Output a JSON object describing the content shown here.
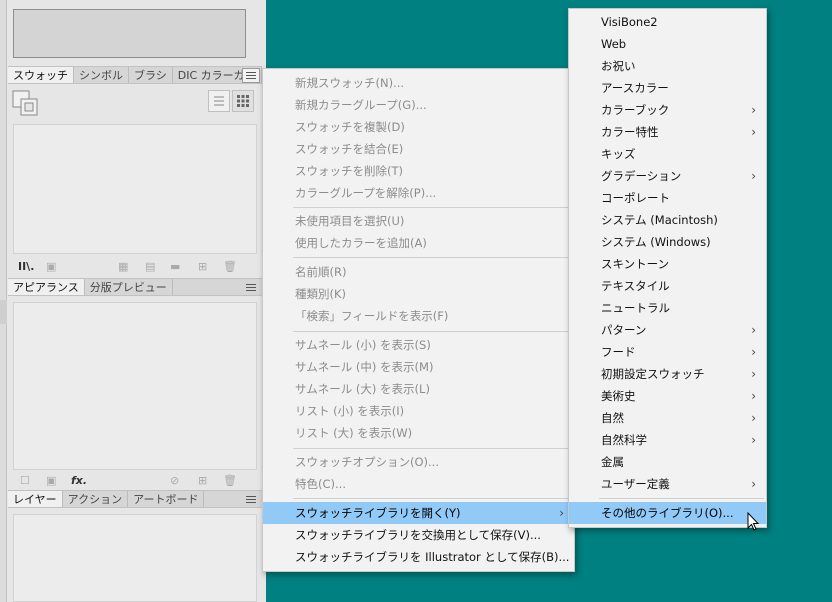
{
  "swatches_panel": {
    "tabs": [
      "スウォッチ",
      "シンボル",
      "ブラシ",
      "DIC カラーガイ"
    ]
  },
  "appearance_panel": {
    "tabs": [
      "アピアランス",
      "分版プレビュー"
    ],
    "fx_label": "fx."
  },
  "layers_panel": {
    "tabs": [
      "レイヤー",
      "アクション",
      "アートボード"
    ]
  },
  "panel_menu": {
    "items": [
      "新規スウォッチ(N)...",
      "新規カラーグループ(G)...",
      "スウォッチを複製(D)",
      "スウォッチを結合(E)",
      "スウォッチを削除(T)",
      "カラーグループを解除(P)...",
      "未使用項目を選択(U)",
      "使用したカラーを追加(A)",
      "名前順(R)",
      "種類別(K)",
      "「検索」フィールドを表示(F)",
      "サムネール (小) を表示(S)",
      "サムネール (中) を表示(M)",
      "サムネール (大) を表示(L)",
      "リスト (小) を表示(I)",
      "リスト (大) を表示(W)",
      "スウォッチオプション(O)...",
      "特色(C)...",
      "スウォッチライブラリを開く(Y)",
      "スウォッチライブラリを交換用として保存(V)...",
      "スウォッチライブラリを Illustrator として保存(B)..."
    ]
  },
  "library_submenu": {
    "items": [
      "VisiBone2",
      "Web",
      "お祝い",
      "アースカラー",
      "カラーブック",
      "カラー特性",
      "キッズ",
      "グラデーション",
      "コーポレート",
      "システム (Macintosh)",
      "システム (Windows)",
      "スキントーン",
      "テキスタイル",
      "ニュートラル",
      "パターン",
      "フード",
      "初期設定スウォッチ",
      "美術史",
      "自然",
      "自然科学",
      "金属",
      "ユーザー定義",
      "その他のライブラリ(O)..."
    ]
  },
  "icons": {
    "submenu_arrow": "›"
  },
  "colors": {
    "desktop": "#008080",
    "menu_highlight": "#91c9f7",
    "disabled_text": "#8c8c8c"
  }
}
